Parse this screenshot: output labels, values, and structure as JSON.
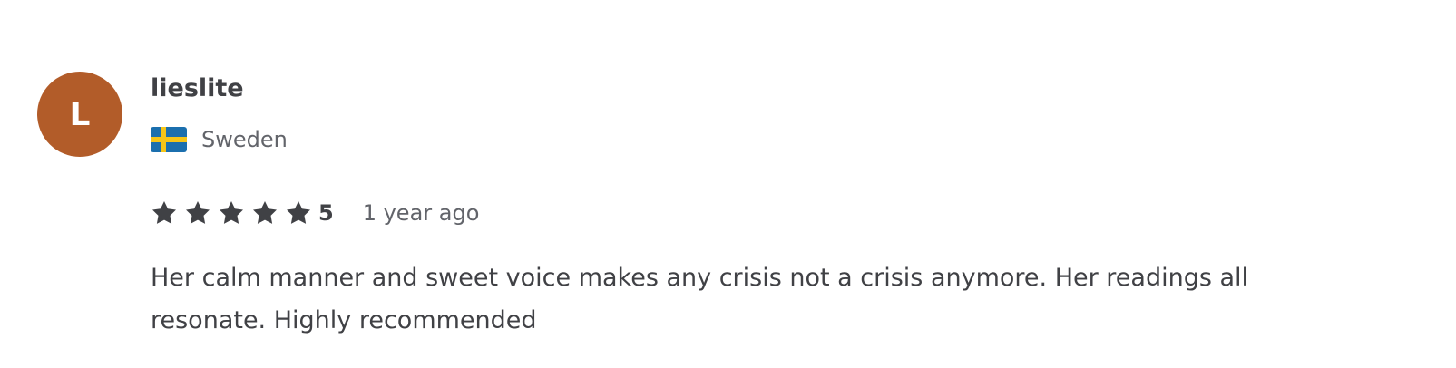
{
  "review": {
    "avatar": {
      "initial": "L",
      "color": "#b25c29"
    },
    "username": "lieslite",
    "country": {
      "flag_icon": "sweden-flag-icon",
      "name": "Sweden"
    },
    "rating": {
      "stars": 5,
      "max_stars": 5,
      "score": "5",
      "star_color": "#404145"
    },
    "time_ago": "1 year ago",
    "text": "Her calm manner and sweet voice makes any crisis not a crisis anymore. Her readings all resonate. Highly recommended"
  }
}
